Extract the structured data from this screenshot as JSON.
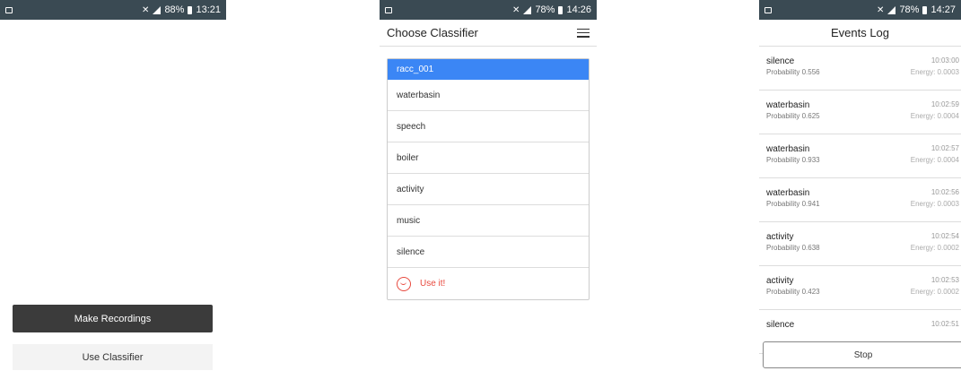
{
  "screen1": {
    "status_time": "13:21",
    "status_battery": "88%",
    "make_recordings": "Make Recordings",
    "use_classifier": "Use Classifier"
  },
  "screen2": {
    "status_time": "14:26",
    "status_battery": "78%",
    "title": "Choose Classifier",
    "items": [
      "racc_001",
      "waterbasin",
      "speech",
      "boiler",
      "activity",
      "music",
      "silence"
    ],
    "use_it": "Use it!"
  },
  "screen3": {
    "status_time": "14:27",
    "status_battery": "78%",
    "title": "Events Log",
    "events": [
      {
        "label": "silence",
        "probability": "Probability 0.556",
        "time": "10:03:00",
        "energy": "Energy: 0.0003"
      },
      {
        "label": "waterbasin",
        "probability": "Probability 0.625",
        "time": "10:02:59",
        "energy": "Energy: 0.0004"
      },
      {
        "label": "waterbasin",
        "probability": "Probability 0.933",
        "time": "10:02:57",
        "energy": "Energy: 0.0004"
      },
      {
        "label": "waterbasin",
        "probability": "Probability 0.941",
        "time": "10:02:56",
        "energy": "Energy: 0.0003"
      },
      {
        "label": "activity",
        "probability": "Probability 0.638",
        "time": "10:02:54",
        "energy": "Energy: 0.0002"
      },
      {
        "label": "activity",
        "probability": "Probability 0.423",
        "time": "10:02:53",
        "energy": "Energy: 0.0002"
      },
      {
        "label": "silence",
        "probability": "",
        "time": "10:02:51",
        "energy": ""
      }
    ],
    "stop": "Stop"
  },
  "colors": {
    "status_bar": "#3a4a53",
    "selected": "#3b86f5",
    "accent_red": "#e84a3f",
    "dark_button": "#3b3b3b"
  }
}
